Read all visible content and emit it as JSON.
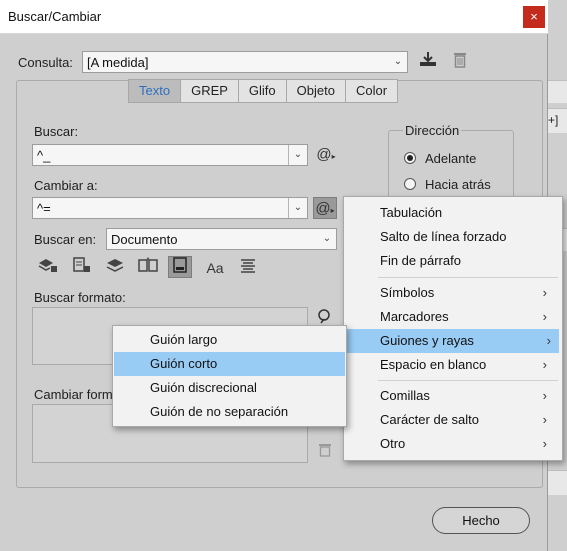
{
  "window": {
    "title": "Buscar/Cambiar",
    "close_glyph": "×"
  },
  "query": {
    "label": "Consulta:",
    "value": "[A medida]"
  },
  "tabs": [
    "Texto",
    "GREP",
    "Glifo",
    "Objeto",
    "Color"
  ],
  "active_tab": "Texto",
  "find": {
    "label": "Buscar:",
    "value": "^_"
  },
  "change": {
    "label": "Cambiar a:",
    "value": "^="
  },
  "direction": {
    "label": "Dirección",
    "options": [
      "Adelante",
      "Hacia atrás"
    ],
    "selected": "Adelante"
  },
  "search_in": {
    "label": "Buscar en:",
    "value": "Documento"
  },
  "find_format": {
    "label": "Buscar formato:"
  },
  "change_format": {
    "label": "Cambiar form"
  },
  "done_button": "Hecho",
  "background_fragment": "+]",
  "special_chars_menu": {
    "items": [
      {
        "label": "Tabulación",
        "submenu": false
      },
      {
        "label": "Salto de línea forzado",
        "submenu": false
      },
      {
        "label": "Fin de párrafo",
        "submenu": false
      },
      {
        "label": "Símbolos",
        "submenu": true
      },
      {
        "label": "Marcadores",
        "submenu": true
      },
      {
        "label": "Guiones y rayas",
        "submenu": true,
        "highlighted": true
      },
      {
        "label": "Espacio en blanco",
        "submenu": true
      },
      {
        "label": "Comillas",
        "submenu": true
      },
      {
        "label": "Carácter de salto",
        "submenu": true
      },
      {
        "label": "Otro",
        "submenu": true
      }
    ]
  },
  "dashes_submenu": {
    "items": [
      {
        "label": "Guión largo"
      },
      {
        "label": "Guión corto",
        "highlighted": true
      },
      {
        "label": "Guión discrecional"
      },
      {
        "label": "Guión de no separación"
      }
    ]
  },
  "colors": {
    "highlight": "#99ccf5",
    "active_tab_text": "#2e6fbf",
    "close_button": "#c42b1c"
  }
}
